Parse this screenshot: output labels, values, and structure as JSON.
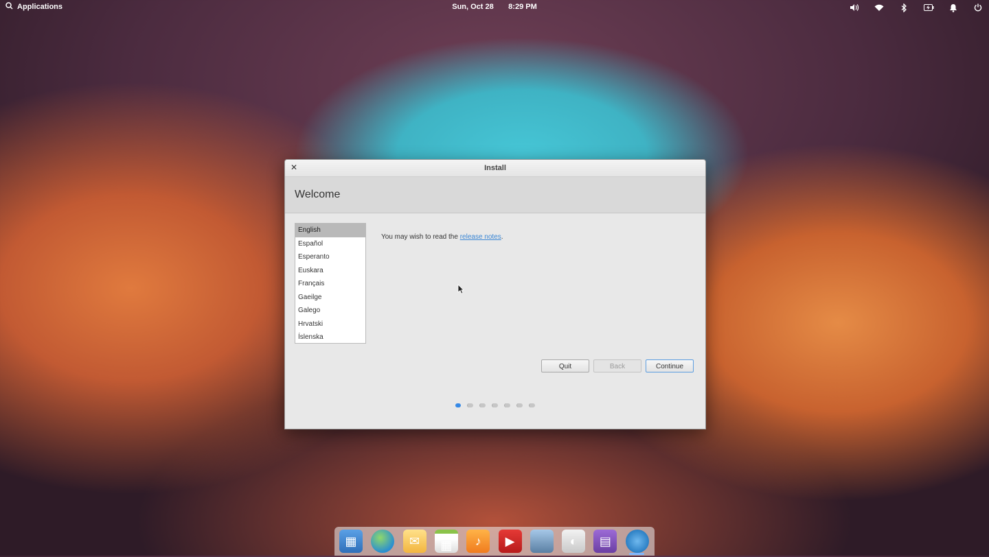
{
  "panel": {
    "applications_label": "Applications",
    "date": "Sun, Oct 28",
    "time": "8:29 PM",
    "indicators": [
      "volume-icon",
      "wifi-icon",
      "bluetooth-icon",
      "battery-icon",
      "notifications-icon",
      "power-icon"
    ]
  },
  "window": {
    "title": "Install",
    "header": "Welcome",
    "languages": [
      "English",
      "Español",
      "Esperanto",
      "Euskara",
      "Français",
      "Gaeilge",
      "Galego",
      "Hrvatski",
      "Íslenska"
    ],
    "selected_language": "English",
    "notes_prefix": "You may wish to read the ",
    "notes_link": "release notes",
    "notes_suffix": ".",
    "buttons": {
      "quit": "Quit",
      "back": "Back",
      "continue": "Continue"
    },
    "progress": {
      "total_steps": 7,
      "current_step": 1
    }
  },
  "dock": {
    "apps": [
      "multitasking-view-icon",
      "web-browser-icon",
      "mail-icon",
      "calendar-icon",
      "music-icon",
      "videos-icon",
      "photos-icon",
      "system-settings-icon",
      "app-center-icon",
      "installer-icon"
    ]
  },
  "colors": {
    "accent": "#3689e6",
    "link": "#3a86d4"
  }
}
